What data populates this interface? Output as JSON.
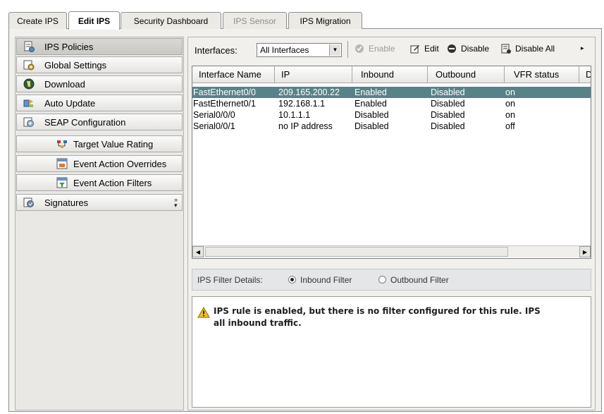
{
  "tabs": [
    {
      "label": "Create IPS",
      "state": "normal"
    },
    {
      "label": "Edit IPS",
      "state": "active"
    },
    {
      "label": "Security Dashboard",
      "state": "normal"
    },
    {
      "label": "IPS Sensor",
      "state": "disabled"
    },
    {
      "label": "IPS Migration",
      "state": "normal"
    }
  ],
  "sidebar": {
    "items": [
      {
        "label": "IPS Policies",
        "icon": "ips-policies-icon",
        "selected": true
      },
      {
        "label": "Global Settings",
        "icon": "global-settings-icon"
      },
      {
        "label": "Download",
        "icon": "download-icon"
      },
      {
        "label": "Auto Update",
        "icon": "auto-update-icon"
      },
      {
        "label": "SEAP Configuration",
        "icon": "seap-configuration-icon"
      },
      {
        "label": "Target Value Rating",
        "icon": "target-value-rating-icon"
      },
      {
        "label": "Event Action Overrides",
        "icon": "event-action-overrides-icon"
      },
      {
        "label": "Event Action Filters",
        "icon": "event-action-filters-icon"
      },
      {
        "label": "Signatures",
        "icon": "signatures-icon"
      }
    ]
  },
  "toolbar": {
    "interfaces_label": "Interfaces:",
    "interfaces_value": "All Interfaces",
    "enable_label": "Enable",
    "edit_label": "Edit",
    "disable_label": "Disable",
    "disable_all_label": "Disable All",
    "more_glyph": "▸"
  },
  "table": {
    "columns": [
      "Interface Name",
      "IP",
      "Inbound",
      "Outbound",
      "VFR status",
      "D"
    ],
    "rows": [
      [
        "FastEthernet0/0",
        "209.165.200.22",
        "Enabled",
        "Disabled",
        "on"
      ],
      [
        "FastEthernet0/1",
        "192.168.1.1",
        "Enabled",
        "Disabled",
        "on"
      ],
      [
        "Serial0/0/0",
        "10.1.1.1",
        "Disabled",
        "Disabled",
        "on"
      ],
      [
        "Serial0/0/1",
        "no IP address",
        "Disabled",
        "Disabled",
        "off"
      ]
    ],
    "selected_row": 0
  },
  "filter": {
    "label": "IPS Filter Details:",
    "inbound_label": "Inbound Filter",
    "outbound_label": "Outbound Filter",
    "selected": "inbound"
  },
  "message": {
    "line1": "IPS rule is enabled, but there is no filter configured for this rule. IPS",
    "line2": "all inbound traffic."
  },
  "colors": {
    "selected_row": "#58828a",
    "warning": "#f0c020"
  }
}
